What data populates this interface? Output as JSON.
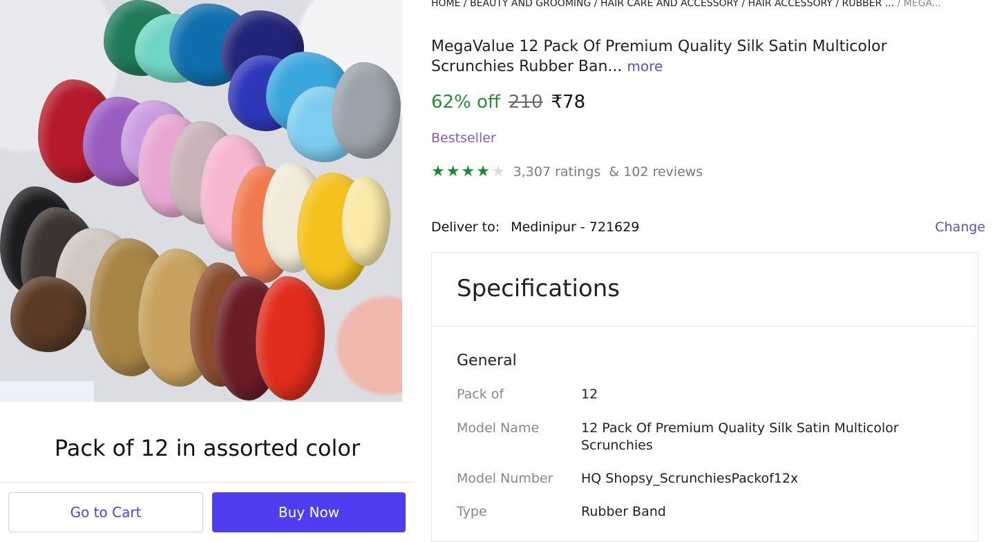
{
  "breadcrumb": {
    "path": "HOME / BEAUTY AND GROOMING / HAIR CARE AND ACCESSORY / HAIR ACCESSORY / RUBBER ...",
    "current": "/ MEGA..."
  },
  "product": {
    "title": "MegaValue 12 Pack Of Premium Quality Silk Satin Multicolor Scrunchies Rubber Ban...",
    "more_label": "more",
    "discount": "62% off",
    "mrp": "210",
    "price": "₹78",
    "badge": "Bestseller",
    "rating_value": 4,
    "rating_max": 5,
    "ratings_text": "3,307 ratings",
    "reviews_text": "& 102 reviews",
    "image_caption": "Pack of 12 in assorted color"
  },
  "delivery": {
    "label": "Deliver to:",
    "location": "Medinipur - 721629",
    "change_label": "Change"
  },
  "actions": {
    "cart_label": "Go to Cart",
    "buy_label": "Buy Now"
  },
  "specifications": {
    "heading": "Specifications",
    "group": "General",
    "rows": [
      {
        "key": "Pack of",
        "value": "12"
      },
      {
        "key": "Model Name",
        "value": "12 Pack Of Premium Quality Silk Satin Multicolor Scrunchies"
      },
      {
        "key": "Model Number",
        "value": "HQ Shopsy_ScrunchiesPackof12x"
      },
      {
        "key": "Type",
        "value": "Rubber Band"
      }
    ]
  },
  "colors": {
    "accent": "#4f3ef0",
    "link": "#5b53a8",
    "discount": "#2f8a3a",
    "star": "#1b8a2e",
    "badge": "#8a5aa8"
  }
}
